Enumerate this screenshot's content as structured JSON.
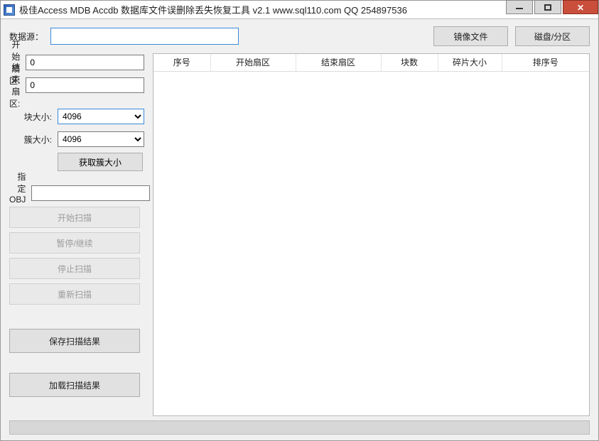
{
  "title": "极佳Access MDB Accdb 数据库文件误删除丢失恢复工具  v2.1  www.sql110.com  QQ 254897536",
  "top": {
    "source_label": "数据源：",
    "source_value": "",
    "image_file_btn": "镜像文件",
    "disk_partition_btn": "磁盘/分区"
  },
  "left": {
    "start_sector_label": "开始扇区:",
    "start_sector_value": "0",
    "end_sector_label": "结束扇区:",
    "end_sector_value": "0",
    "block_size_label": "块大小:",
    "block_size_value": "4096",
    "cluster_size_label": "簇大小:",
    "cluster_size_value": "4096",
    "get_cluster_btn": "获取簇大小",
    "obj_label": "指定OBJ号:",
    "obj_value": "",
    "start_scan_btn": "开始扫描",
    "pause_btn": "暂停/继续",
    "stop_btn": "停止扫描",
    "rescan_btn": "重新扫描",
    "save_result_btn": "保存扫描结果",
    "load_result_btn": "加载扫描结果"
  },
  "table": {
    "columns": [
      "序号",
      "开始扇区",
      "结束扇区",
      "块数",
      "碎片大小",
      "排序号"
    ]
  }
}
